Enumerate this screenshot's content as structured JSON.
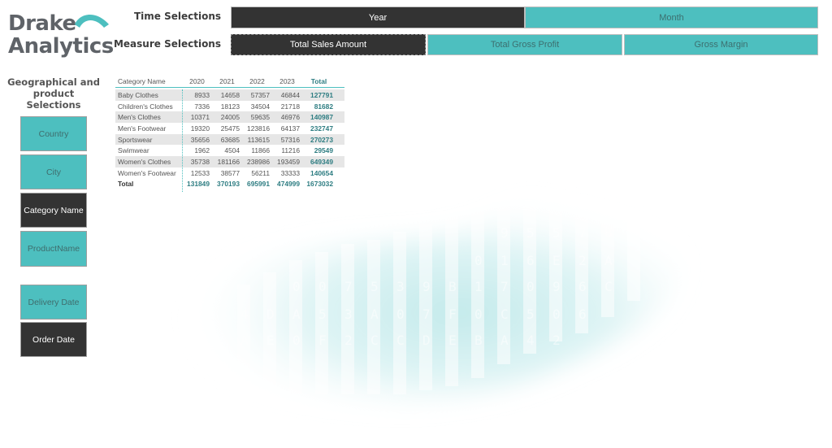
{
  "brand": {
    "line1": "Drake",
    "line2": "Analytics"
  },
  "colors": {
    "teal": "#4dbfbf",
    "dark": "#333333",
    "total_text": "#2e7d82"
  },
  "time_selections": {
    "label": "Time Selections",
    "options": [
      {
        "label": "Year",
        "selected": true
      },
      {
        "label": "Month",
        "selected": false
      }
    ]
  },
  "measure_selections": {
    "label": "Measure Selections",
    "options": [
      {
        "label": "Total Sales Amount",
        "selected": true
      },
      {
        "label": "Total Gross Profit",
        "selected": false
      },
      {
        "label": "Gross Margin",
        "selected": false
      }
    ]
  },
  "geo_panel": {
    "title": "Geographical and product Selections",
    "buttons": [
      {
        "label": "Country",
        "selected": false
      },
      {
        "label": "City",
        "selected": false
      },
      {
        "label": "Category Name",
        "selected": true
      },
      {
        "label": "ProductName",
        "selected": false
      },
      {
        "label": "Delivery Date",
        "selected": false
      },
      {
        "label": "Order Date",
        "selected": true
      }
    ]
  },
  "matrix": {
    "columns": [
      "Category Name",
      "2020",
      "2021",
      "2022",
      "2023",
      "Total"
    ],
    "rows": [
      {
        "name": "Baby Clothes",
        "values": [
          "8933",
          "14658",
          "57357",
          "46844"
        ],
        "total": "127791"
      },
      {
        "name": "Children's Clothes",
        "values": [
          "7336",
          "18123",
          "34504",
          "21718"
        ],
        "total": "81682"
      },
      {
        "name": "Men's Clothes",
        "values": [
          "10371",
          "24005",
          "59635",
          "46976"
        ],
        "total": "140987"
      },
      {
        "name": "Men's Footwear",
        "values": [
          "19320",
          "25475",
          "123816",
          "64137"
        ],
        "total": "232747"
      },
      {
        "name": "Sportswear",
        "values": [
          "35656",
          "63685",
          "113615",
          "57316"
        ],
        "total": "270273"
      },
      {
        "name": "Swimwear",
        "values": [
          "1962",
          "4504",
          "11866",
          "11216"
        ],
        "total": "29549"
      },
      {
        "name": "Women's Clothes",
        "values": [
          "35738",
          "181166",
          "238986",
          "193459"
        ],
        "total": "649349"
      },
      {
        "name": "Women's Footwear",
        "values": [
          "12533",
          "38577",
          "56211",
          "33333"
        ],
        "total": "140654"
      }
    ],
    "total_row": {
      "name": "Total",
      "values": [
        "131849",
        "370193",
        "695991",
        "474999"
      ],
      "total": "1673032"
    }
  }
}
